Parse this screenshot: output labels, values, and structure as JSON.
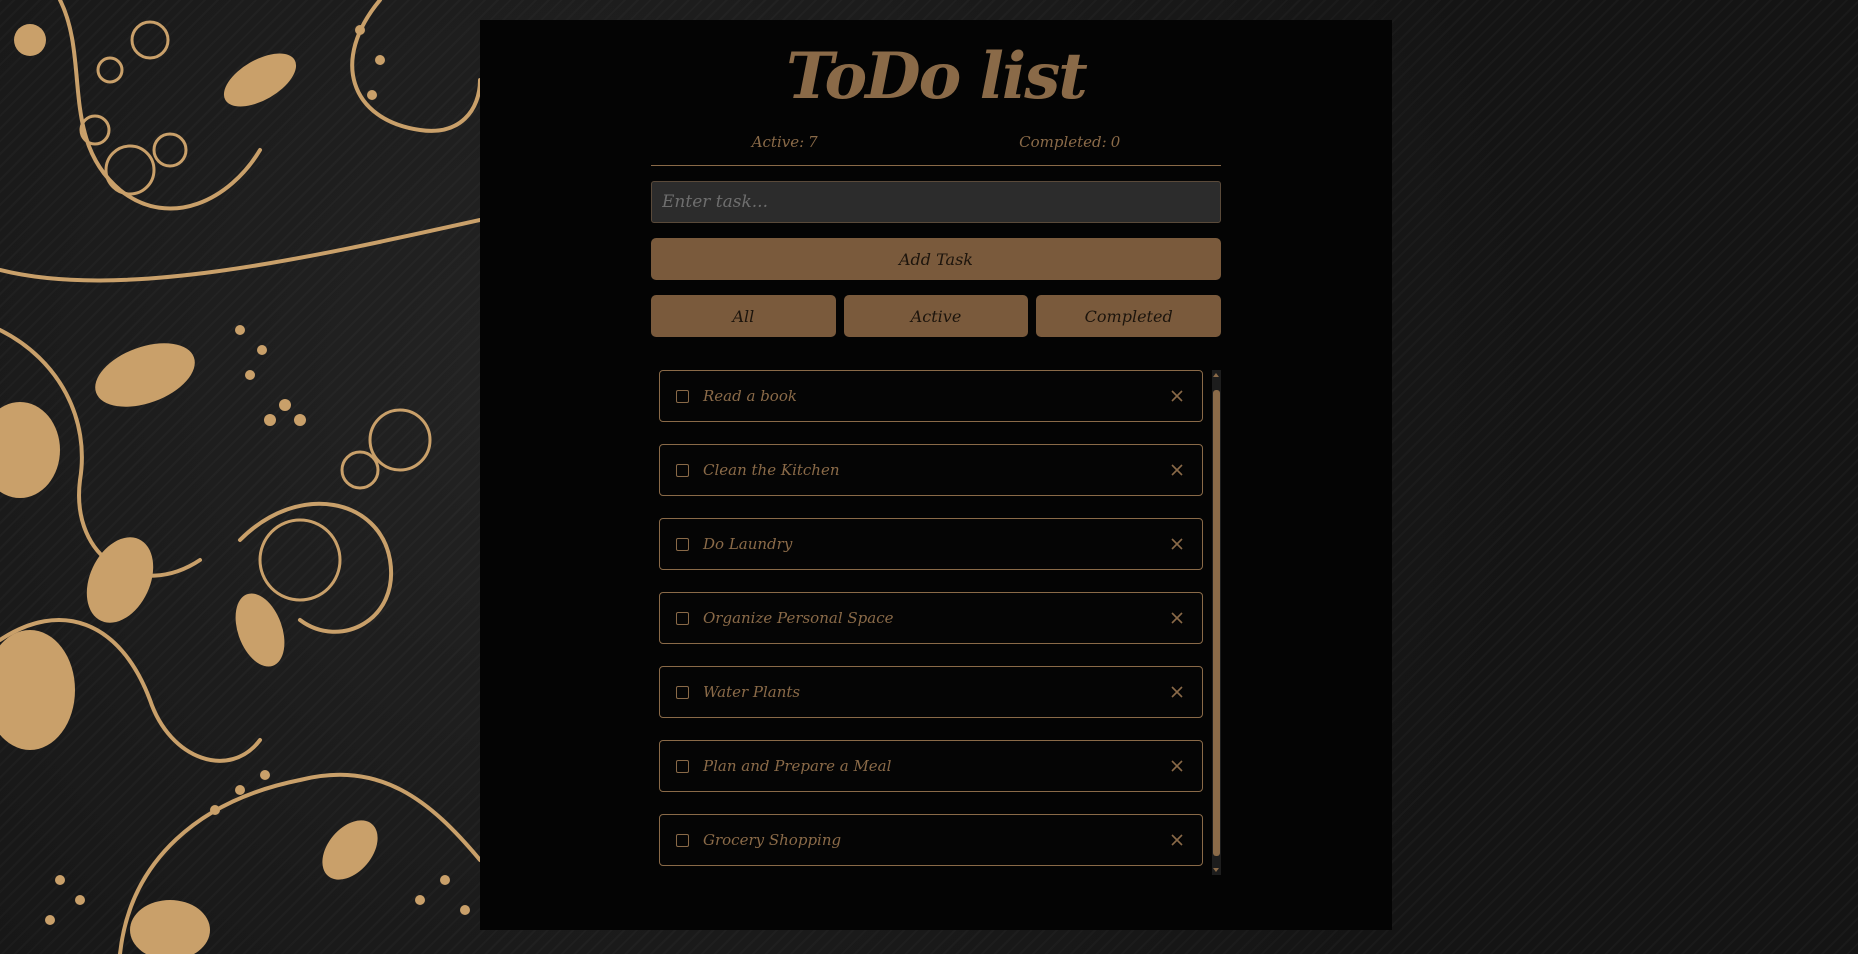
{
  "app": {
    "title": "ToDo list",
    "counters": {
      "active_label": "Active:",
      "active_count": "7",
      "completed_label": "Completed:",
      "completed_count": "0"
    },
    "input": {
      "placeholder": "Enter task...",
      "value": ""
    },
    "add_button_label": "Add Task",
    "filters": [
      {
        "label": "All"
      },
      {
        "label": "Active"
      },
      {
        "label": "Completed"
      }
    ],
    "tasks": [
      {
        "label": "Read a book",
        "completed": false
      },
      {
        "label": "Clean the Kitchen",
        "completed": false
      },
      {
        "label": "Do Laundry",
        "completed": false
      },
      {
        "label": "Organize Personal Space",
        "completed": false
      },
      {
        "label": "Water Plants",
        "completed": false
      },
      {
        "label": "Plan and Prepare a Meal",
        "completed": false
      },
      {
        "label": "Grocery Shopping",
        "completed": false
      }
    ],
    "icons": {
      "checkbox": "checkbox-icon",
      "delete": "close-icon",
      "background": "floral-ornament"
    }
  },
  "colors": {
    "accent": "#8a6a48",
    "button": "#7a5a3c",
    "panel": "#040404",
    "input_bg": "#2c2c2c",
    "ornament": "#c9a06a"
  }
}
